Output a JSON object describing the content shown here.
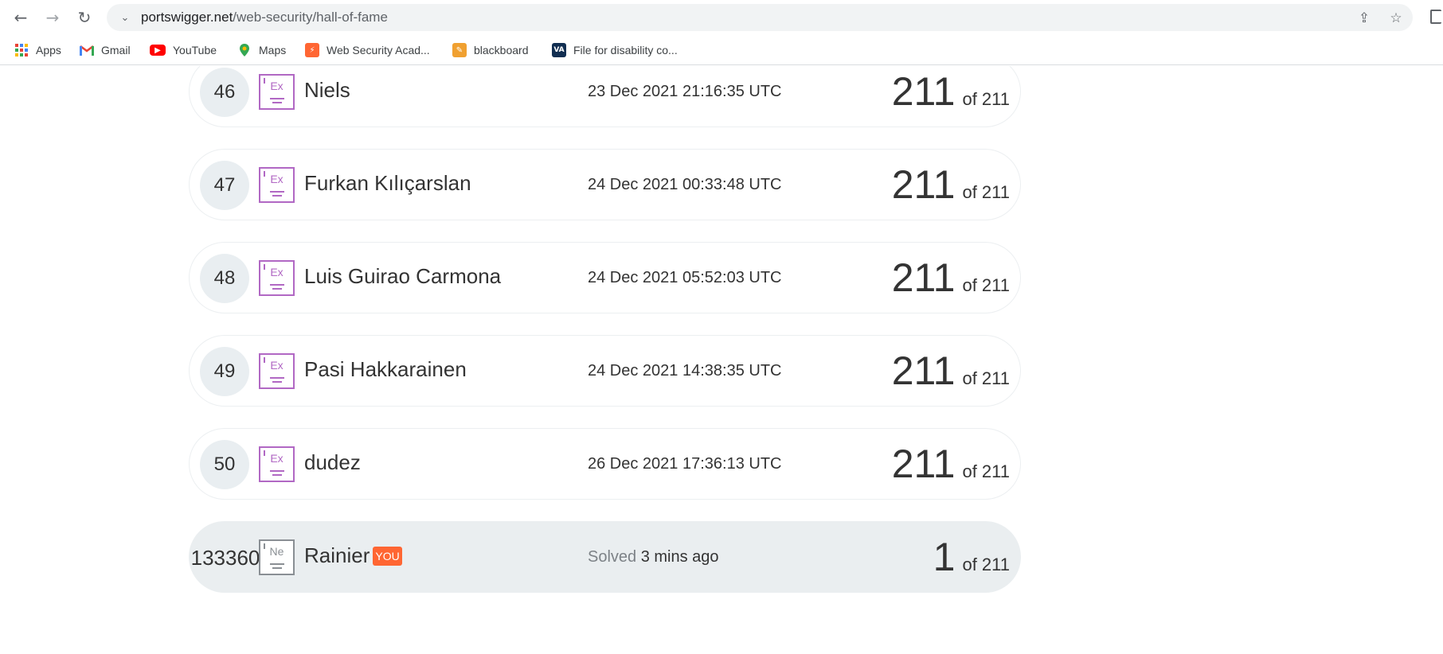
{
  "browser": {
    "url_host": "portswigger.net",
    "url_path": "/web-security/hall-of-fame",
    "icons": [
      "back-arrow-icon",
      "forward-arrow-icon",
      "reload-icon",
      "site-info-icon",
      "share-icon",
      "bookmark-star-icon"
    ]
  },
  "bookmarks": [
    {
      "label": "Apps",
      "icon": "apps-grid-icon"
    },
    {
      "label": "Gmail",
      "icon": "gmail-icon"
    },
    {
      "label": "YouTube",
      "icon": "youtube-icon"
    },
    {
      "label": "Maps",
      "icon": "maps-icon"
    },
    {
      "label": "Web Security Acad...",
      "icon": "web-security-academy-icon"
    },
    {
      "label": "blackboard",
      "icon": "blackboard-icon"
    },
    {
      "label": "File for disability co...",
      "icon": "va-icon",
      "icon_text": "VA"
    }
  ],
  "leaderboard": {
    "rows": [
      {
        "rank": "46",
        "badge": "Ex",
        "name": "Niels",
        "date": "23 Dec 2021 21:16:35 UTC",
        "score": "211",
        "of": "of 211"
      },
      {
        "rank": "47",
        "badge": "Ex",
        "name": "Furkan Kılıçarslan",
        "date": "24 Dec 2021 00:33:48 UTC",
        "score": "211",
        "of": "of 211"
      },
      {
        "rank": "48",
        "badge": "Ex",
        "name": "Luis Guirao Carmona",
        "date": "24 Dec 2021 05:52:03 UTC",
        "score": "211",
        "of": "of 211"
      },
      {
        "rank": "49",
        "badge": "Ex",
        "name": "Pasi Hakkarainen",
        "date": "24 Dec 2021 14:38:35 UTC",
        "score": "211",
        "of": "of 211"
      },
      {
        "rank": "50",
        "badge": "Ex",
        "name": "dudez",
        "date": "26 Dec 2021 17:36:13 UTC",
        "score": "211",
        "of": "of 211"
      }
    ],
    "current_user": {
      "rank": "133360",
      "badge": "Ne",
      "name": "Rainier",
      "you_tag": "YOU",
      "solved_label": "Solved",
      "solved_when": "3 mins ago",
      "score": "1",
      "of": "of 211"
    }
  },
  "colors": {
    "expert_badge": "#b168c4",
    "newbie_badge": "#8a8f94",
    "you_tag": "#ff6633",
    "current_row_bg": "#eaeef0"
  }
}
